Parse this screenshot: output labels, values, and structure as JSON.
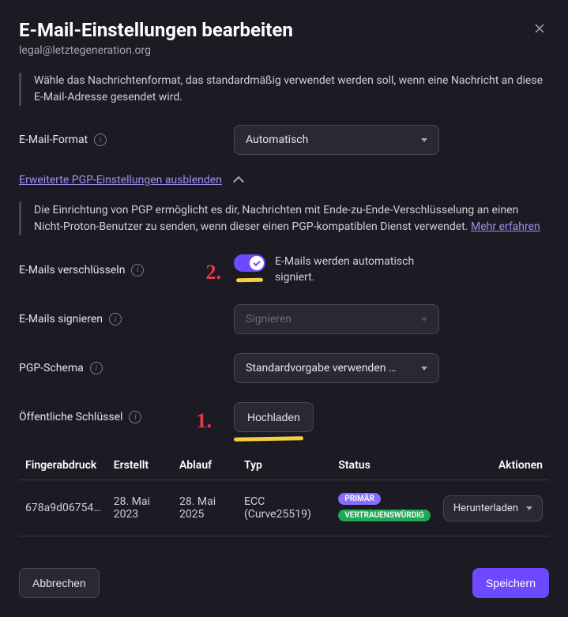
{
  "header": {
    "title": "E-Mail-Einstellungen bearbeiten",
    "email": "legal@letztegeneration.org"
  },
  "format_info": "Wähle das Nachrichtenformat, das standardmäßig verwendet werden soll, wenn eine Nachricht an diese E-Mail-Adresse gesendet wird.",
  "format_label": "E-Mail-Format",
  "format_value": "Automatisch",
  "collapse_link": "Erweiterte PGP-Einstellungen ausblenden",
  "pgp_info": "Die Einrichtung von PGP ermöglicht es dir, Nachrichten mit Ende-zu-Ende-Verschlüsselung an einen Nicht-Proton-Benutzer zu senden, wenn dieser einen PGP-kompatiblen Dienst verwendet. ",
  "learn_more": "Mehr erfahren",
  "encrypt_label": "E-Mails verschlüsseln",
  "encrypt_desc": "E-Mails werden automatisch signiert.",
  "sign_label": "E-Mails signieren",
  "sign_value": "Signieren",
  "schema_label": "PGP-Schema",
  "schema_value": "Standardvorgabe verwenden …",
  "pubkey_label": "Öffentliche Schlüssel",
  "upload_label": "Hochladen",
  "annotations": {
    "one": "1.",
    "two": "2."
  },
  "table": {
    "headers": {
      "fingerprint": "Fingerabdruck",
      "created": "Erstellt",
      "expires": "Ablauf",
      "type": "Typ",
      "status": "Status",
      "actions": "Aktionen"
    },
    "row": {
      "fingerprint": "678a9d06754…",
      "created": "28. Mai 2023",
      "expires": "28. Mai 2025",
      "type": "ECC (Curve25519)",
      "badge_primary": "PRIMÄR",
      "badge_trusted": "VERTRAUENSWÜRDIG",
      "download": "Herunterladen"
    }
  },
  "footer": {
    "cancel": "Abbrechen",
    "save": "Speichern"
  }
}
